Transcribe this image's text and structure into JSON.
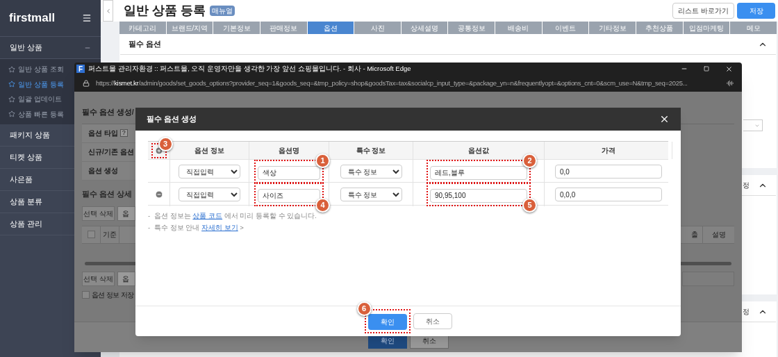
{
  "sidebar": {
    "logo": "firstmall",
    "groups": [
      {
        "label": "일반 상품",
        "expanded": true,
        "children": [
          {
            "label": "일반 상품 조회",
            "selected": false
          },
          {
            "label": "일반 상품 등록",
            "selected": true
          },
          {
            "label": "일괄 업데이트",
            "selected": false
          },
          {
            "label": "상품 빠른 등록",
            "selected": false
          }
        ]
      },
      {
        "label": "패키지 상품",
        "expanded": false
      },
      {
        "label": "티켓 상품",
        "expanded": false
      },
      {
        "label": "사은품",
        "expanded": false
      },
      {
        "label": "상품 분류",
        "expanded": false
      },
      {
        "label": "상품 관리",
        "expanded": false
      }
    ]
  },
  "page": {
    "title": "일반 상품 등록",
    "badge": "매뉴얼",
    "buttons": [
      {
        "label": "리스트 바로가기",
        "kind": "secondary"
      },
      {
        "label": "저장",
        "kind": "primary"
      }
    ],
    "tabs": [
      {
        "label": "카테고리",
        "selected": false
      },
      {
        "label": "브랜드/지역",
        "selected": false
      },
      {
        "label": "기본정보",
        "selected": false
      },
      {
        "label": "판매정보",
        "selected": false
      },
      {
        "label": "옵션",
        "selected": true
      },
      {
        "label": "사진",
        "selected": false
      },
      {
        "label": "상세설명",
        "selected": false
      },
      {
        "label": "공통정보",
        "selected": false
      },
      {
        "label": "배송비",
        "selected": false
      },
      {
        "label": "이벤트",
        "selected": false
      },
      {
        "label": "기타정보",
        "selected": false
      },
      {
        "label": "추천상품",
        "selected": false
      },
      {
        "label": "입점마케팅",
        "selected": false
      },
      {
        "label": "메모",
        "selected": false
      }
    ],
    "cards": [
      {
        "title": "필수 옵션",
        "kind": "full"
      },
      {
        "title": "정",
        "kind": "cut"
      },
      {
        "title": "정",
        "kind": "cut"
      }
    ]
  },
  "browser": {
    "favicon": "F",
    "title": "퍼스트몰 관리자환경 :: 퍼스트몰, 오직 운영자만을 생각한 가장 앞선 쇼핑몰입니다. - 회사 - Microsoft Edge",
    "url_scheme": "https://",
    "url_host": "kismet.kr",
    "url_path": "/admin/goods/set_goods_options?provider_seq=1&goods_seq=&tmp_policy=shop&goodsTax=tax&socialcp_input_type=&package_yn=n&frequentlyopt=&options_cnt=0&scm_use=N&tmp_seq=2025..."
  },
  "background_form": {
    "title": "필수 옵션 생성/",
    "help": "?",
    "select_all": {
      "checked": false
    },
    "rows": [
      "옵션 타입",
      "신규/기존 옵션",
      "옵션 생성"
    ],
    "detail_title": "필수 옵션 상세",
    "toolbar": [
      "선택 삭제",
      "옵"
    ],
    "columns": [
      "기준",
      "출",
      "설명"
    ],
    "bottom_toolbar": [
      "선택 삭제",
      "옵"
    ],
    "save_option": {
      "label": "옵션 정보 저장",
      "checked": false
    },
    "buttons": [
      {
        "label": "확인",
        "kind": "primary"
      },
      {
        "label": "취소",
        "kind": "secondary"
      }
    ]
  },
  "modal": {
    "title": "필수 옵션 생성",
    "add_callout": "3",
    "columns": [
      "옵션 정보",
      "옵션명",
      "특수 정보",
      "옵션값",
      "가격"
    ],
    "rows": [
      {
        "kind": "first",
        "type": "직접입력",
        "name": {
          "value": "색상",
          "callout": "1"
        },
        "special": "특수 정보",
        "values": {
          "value": "레드,블루",
          "callout": "2"
        },
        "price": "0,0"
      },
      {
        "kind": "added",
        "type": "직접입력",
        "name": {
          "value": "사이즈",
          "callout": "4"
        },
        "special": "특수 정보",
        "values": {
          "value": "90,95,100",
          "callout": "5"
        },
        "price": "0,0,0"
      }
    ],
    "notes": [
      {
        "bullet": "-",
        "before": "옵션 정보는 ",
        "link": "상품 코드",
        "after": " 에서 미리 등록할 수 있습니다."
      },
      {
        "bullet": "-",
        "before": "특수 정보 안내 ",
        "link": "자세히 보기",
        "after": " >"
      }
    ],
    "buttons": [
      {
        "label": "확인",
        "kind": "primary",
        "callout": "6"
      },
      {
        "label": "취소",
        "kind": "secondary"
      }
    ]
  }
}
